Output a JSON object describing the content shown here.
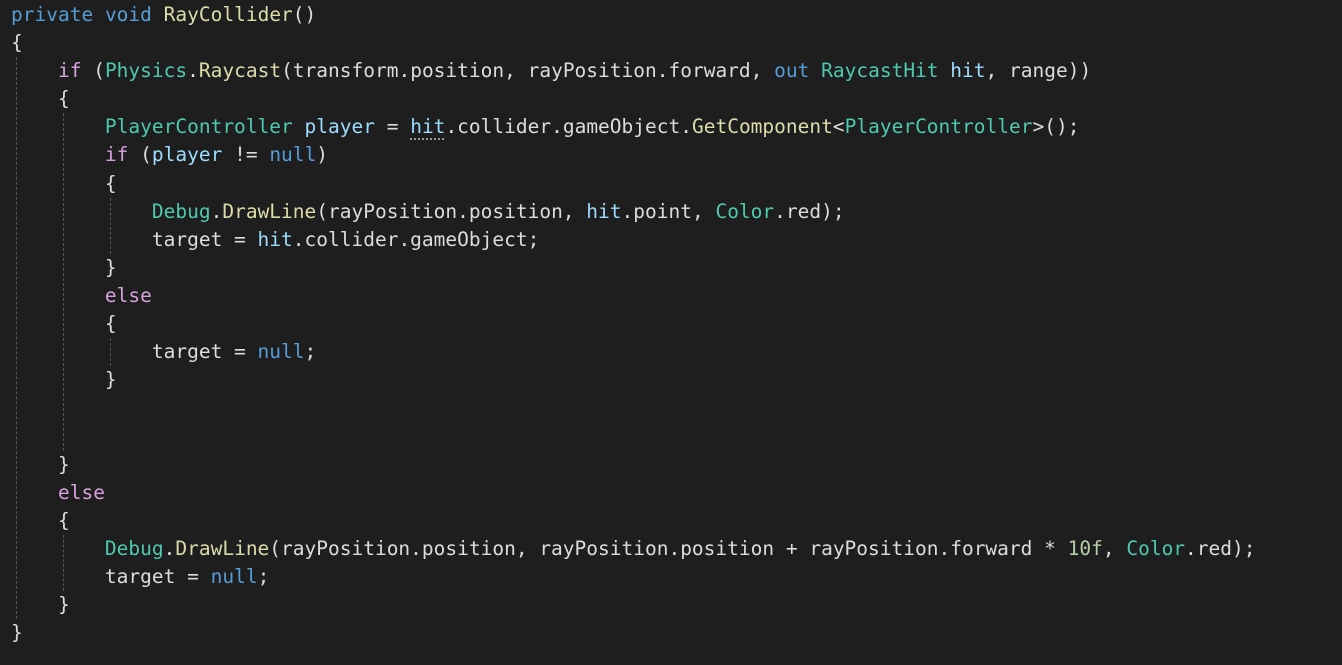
{
  "editor": {
    "colors": {
      "background": "#1e1e1e",
      "keyword": "#569cd6",
      "control_keyword": "#d8a0df",
      "type": "#4ec9b0",
      "method": "#dcdcaa",
      "variable": "#9cdcfe",
      "number": "#b5cea8",
      "plain": "#dcdcdc",
      "indent_guide": "#555555"
    },
    "lines": [
      [
        [
          "kw",
          "private"
        ],
        [
          "plain",
          " "
        ],
        [
          "kw",
          "void"
        ],
        [
          "plain",
          " "
        ],
        [
          "method",
          "RayCollider"
        ],
        [
          "plain",
          "()"
        ]
      ],
      [
        [
          "plain",
          "{"
        ]
      ],
      [
        [
          "plain",
          "    "
        ],
        [
          "ctrl",
          "if"
        ],
        [
          "plain",
          " ("
        ],
        [
          "type",
          "Physics"
        ],
        [
          "plain",
          "."
        ],
        [
          "method",
          "Raycast"
        ],
        [
          "plain",
          "(transform.position, rayPosition.forward, "
        ],
        [
          "kw",
          "out"
        ],
        [
          "plain",
          " "
        ],
        [
          "type",
          "RaycastHit"
        ],
        [
          "plain",
          " "
        ],
        [
          "var",
          "hit"
        ],
        [
          "plain",
          ", range))"
        ]
      ],
      [
        [
          "plain",
          "    {"
        ]
      ],
      [
        [
          "plain",
          "        "
        ],
        [
          "type",
          "PlayerController"
        ],
        [
          "plain",
          " "
        ],
        [
          "var",
          "player"
        ],
        [
          "plain",
          " = "
        ],
        [
          "var",
          "hit",
          "squiggle"
        ],
        [
          "plain",
          ".collider.gameObject."
        ],
        [
          "method",
          "GetComponent"
        ],
        [
          "plain",
          "<"
        ],
        [
          "type",
          "PlayerController"
        ],
        [
          "plain",
          ">();"
        ]
      ],
      [
        [
          "plain",
          "        "
        ],
        [
          "ctrl",
          "if"
        ],
        [
          "plain",
          " ("
        ],
        [
          "var",
          "player"
        ],
        [
          "plain",
          " != "
        ],
        [
          "kw",
          "null"
        ],
        [
          "plain",
          ")"
        ]
      ],
      [
        [
          "plain",
          "        {"
        ]
      ],
      [
        [
          "plain",
          "            "
        ],
        [
          "type",
          "Debug"
        ],
        [
          "plain",
          "."
        ],
        [
          "method",
          "DrawLine"
        ],
        [
          "plain",
          "(rayPosition.position, "
        ],
        [
          "var",
          "hit"
        ],
        [
          "plain",
          ".point, "
        ],
        [
          "type",
          "Color"
        ],
        [
          "plain",
          ".red);"
        ]
      ],
      [
        [
          "plain",
          "            target = "
        ],
        [
          "var",
          "hit"
        ],
        [
          "plain",
          ".collider.gameObject;"
        ]
      ],
      [
        [
          "plain",
          "        }"
        ]
      ],
      [
        [
          "plain",
          "        "
        ],
        [
          "ctrl",
          "else"
        ]
      ],
      [
        [
          "plain",
          "        {"
        ]
      ],
      [
        [
          "plain",
          "            target = "
        ],
        [
          "kw",
          "null"
        ],
        [
          "plain",
          ";"
        ]
      ],
      [
        [
          "plain",
          "        }"
        ]
      ],
      [],
      [],
      [
        [
          "plain",
          "    }"
        ]
      ],
      [
        [
          "plain",
          "    "
        ],
        [
          "ctrl",
          "else"
        ]
      ],
      [
        [
          "plain",
          "    {"
        ]
      ],
      [
        [
          "plain",
          "        "
        ],
        [
          "type",
          "Debug"
        ],
        [
          "plain",
          "."
        ],
        [
          "method",
          "DrawLine"
        ],
        [
          "plain",
          "(rayPosition.position, rayPosition.position + rayPosition.forward * "
        ],
        [
          "num",
          "10f"
        ],
        [
          "plain",
          ", "
        ],
        [
          "type",
          "Color"
        ],
        [
          "plain",
          ".red);"
        ]
      ],
      [
        [
          "plain",
          "        target = "
        ],
        [
          "kw",
          "null"
        ],
        [
          "plain",
          ";"
        ]
      ],
      [
        [
          "plain",
          "    }"
        ]
      ],
      [
        [
          "plain",
          "}"
        ]
      ]
    ]
  }
}
